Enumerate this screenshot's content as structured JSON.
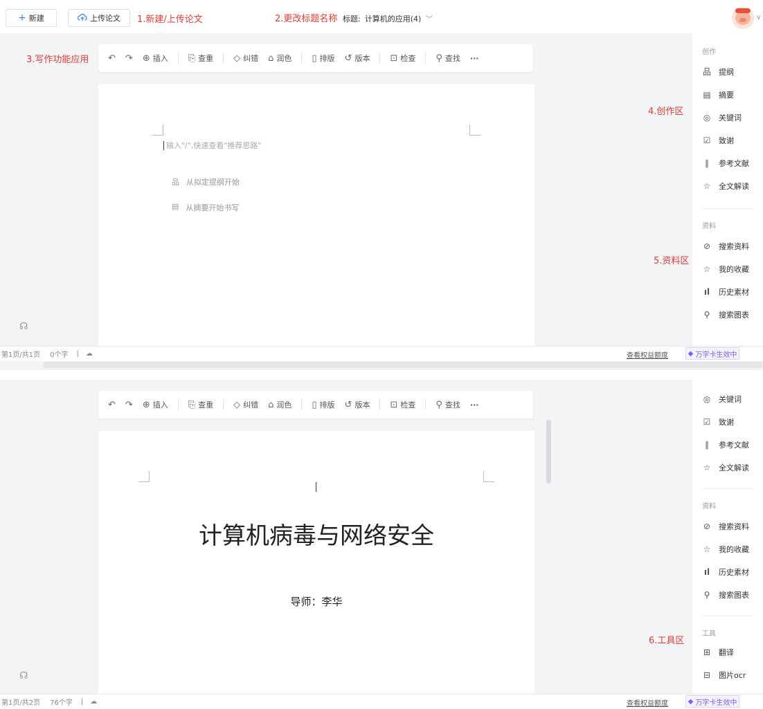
{
  "header": {
    "new_label": "新建",
    "upload_label": "上传论文",
    "annot_new_upload": "1.新建/上传论文",
    "annot_title": "2.更改标题名称",
    "title_prefix": "标题:",
    "title_value": "计算机的应用(4)"
  },
  "annotations": {
    "writing": "3.写作功能应用",
    "create": "4.创作区",
    "materials": "5.资料区",
    "tools": "6.工具区"
  },
  "toolbar": {
    "insert": "插入",
    "dup_check": "查重",
    "correct": "纠错",
    "polish": "润色",
    "layout": "排版",
    "version": "版本",
    "check": "检查",
    "find": "查找",
    "more": "···"
  },
  "editor_top": {
    "placeholder": "输入\"/\",快速查看\"推荐思路\"",
    "opt_outline": "从拟定提纲开始",
    "opt_abstract": "从摘要开始书写"
  },
  "document": {
    "title": "计算机病毒与网络安全",
    "advisor": "导师：李华"
  },
  "sidebar": {
    "create_label": "创作",
    "outline": "提纲",
    "abstract": "摘要",
    "keywords": "关键词",
    "thanks": "致谢",
    "references": "参考文献",
    "full_read": "全文解读",
    "materials_label": "资料",
    "search_materials": "搜索资料",
    "favorites": "我的收藏",
    "history": "历史素材",
    "search_charts": "搜索图表",
    "tools_label": "工具",
    "translate": "翻译",
    "ocr": "图片ocr"
  },
  "status_top": {
    "pages": "第1页/共1页",
    "words": "0个字",
    "sep": "|"
  },
  "status_bottom": {
    "pages": "第1页/共2页",
    "words": "76个字",
    "sep": "|"
  },
  "status": {
    "quota_link": "查看权益额度",
    "badge": "万字卡生效中"
  },
  "colors": {
    "annotation": "#e53935",
    "badge": "#7b5cff"
  }
}
